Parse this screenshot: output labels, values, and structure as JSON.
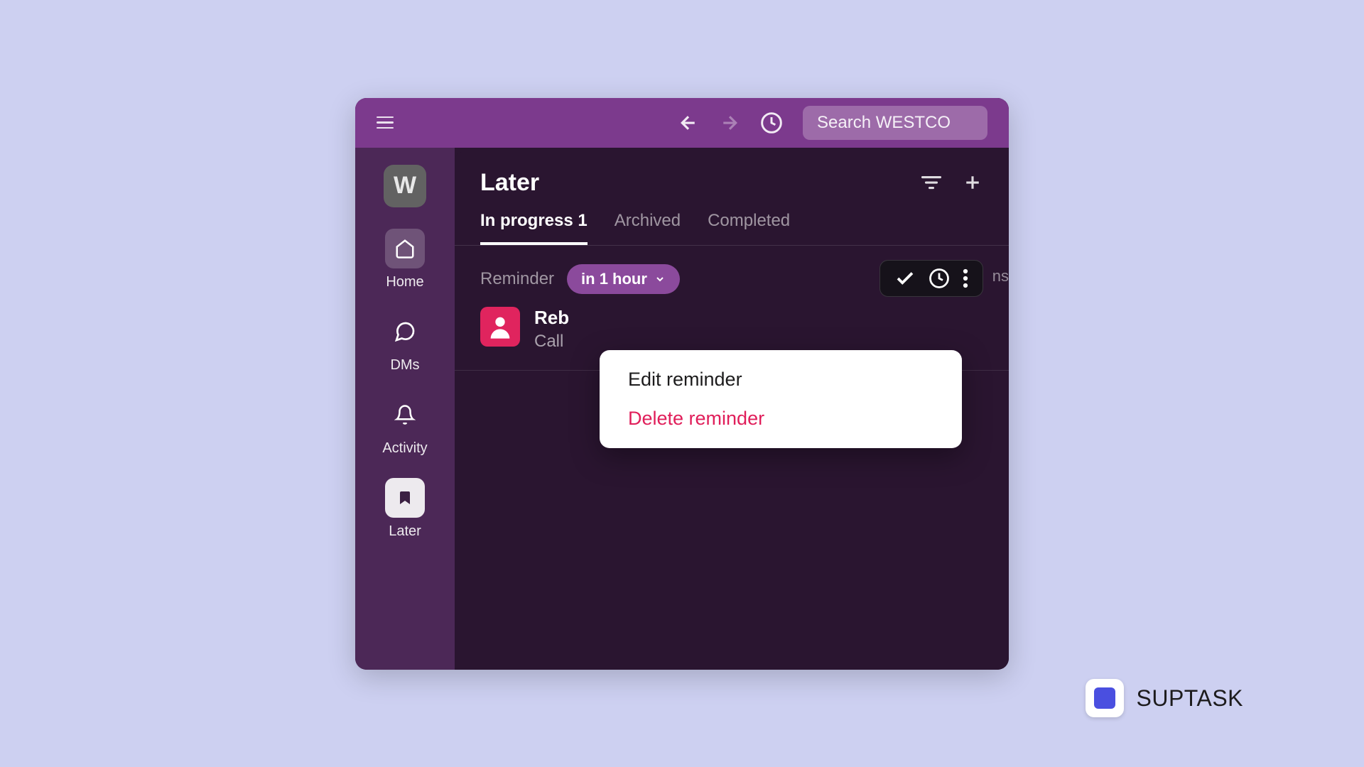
{
  "topbar": {
    "search_placeholder": "Search WESTCO"
  },
  "sidebar": {
    "workspace_letter": "W",
    "items": [
      {
        "label": "Home"
      },
      {
        "label": "DMs"
      },
      {
        "label": "Activity"
      },
      {
        "label": "Later"
      }
    ]
  },
  "content": {
    "title": "Later",
    "tabs": [
      {
        "label": "In progress 1"
      },
      {
        "label": "Archived"
      },
      {
        "label": "Completed"
      }
    ],
    "reminder": {
      "label": "Reminder",
      "time_chip": "in 1 hour",
      "trailing_text": "ns",
      "sender": "Reb",
      "description": "Call"
    }
  },
  "context_menu": {
    "edit": "Edit reminder",
    "delete": "Delete reminder"
  },
  "watermark": {
    "text": "SUPTASK"
  }
}
